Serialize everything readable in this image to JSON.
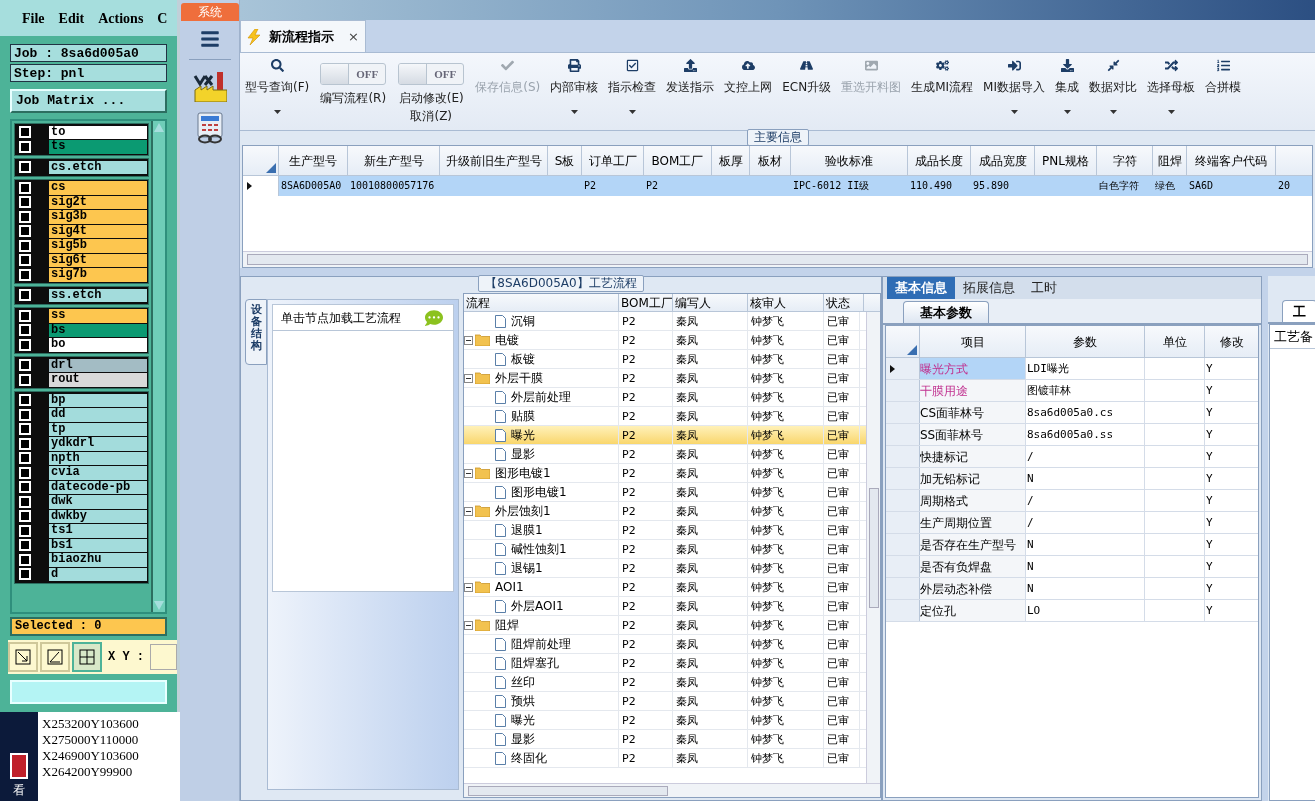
{
  "legacy_app": {
    "menus": [
      "File",
      "Edit",
      "Actions",
      "C"
    ],
    "job": "Job : 8sa6d005a0",
    "step": "Step: pnl",
    "matrix_button": "Job Matrix ...",
    "layer_groups": [
      {
        "layers": [
          {
            "name": "to",
            "color": "#ffffff",
            "checked": false
          },
          {
            "name": "ts",
            "color": "#0b9a72",
            "checked": false
          }
        ]
      },
      {
        "layers": [
          {
            "name": "cs.etch",
            "color": "#a3dcdc",
            "checked": false
          }
        ]
      },
      {
        "layers": [
          {
            "name": "cs",
            "color": "#fdc64f",
            "checked": false
          },
          {
            "name": "sig2t",
            "color": "#fdc64f",
            "checked": false
          },
          {
            "name": "sig3b",
            "color": "#fdc64f",
            "checked": false
          },
          {
            "name": "sig4t",
            "color": "#fdc64f",
            "checked": false
          },
          {
            "name": "sig5b",
            "color": "#fdc64f",
            "checked": false
          },
          {
            "name": "sig6t",
            "color": "#fdc64f",
            "checked": false
          },
          {
            "name": "sig7b",
            "color": "#fdc64f",
            "checked": false
          }
        ]
      },
      {
        "layers": [
          {
            "name": "ss.etch",
            "color": "#a3dcdc",
            "checked": false
          }
        ]
      },
      {
        "layers": [
          {
            "name": "ss",
            "color": "#fdc64f",
            "checked": false
          },
          {
            "name": "bs",
            "color": "#0b9a72",
            "checked": false
          },
          {
            "name": "bo",
            "color": "#ffffff",
            "checked": false
          }
        ]
      },
      {
        "layers": [
          {
            "name": "drl",
            "color": "#a3bcc4",
            "checked": false
          },
          {
            "name": "rout",
            "color": "#d9d9d9",
            "checked": false
          }
        ]
      },
      {
        "layers": [
          {
            "name": "bp",
            "color": "#a3dcdc",
            "checked": false
          },
          {
            "name": "dd",
            "color": "#a3dcdc",
            "checked": false
          },
          {
            "name": "tp",
            "color": "#a3dcdc",
            "checked": false
          },
          {
            "name": "ydkdrl",
            "color": "#a3dcdc",
            "checked": false
          },
          {
            "name": "npth",
            "color": "#a3dcdc",
            "checked": false
          },
          {
            "name": "cvia",
            "color": "#a3dcdc",
            "checked": false
          },
          {
            "name": "datecode-pb",
            "color": "#a3dcdc",
            "checked": false
          },
          {
            "name": "dwk",
            "color": "#a3dcdc",
            "checked": false
          },
          {
            "name": "dwkby",
            "color": "#a3dcdc",
            "checked": false
          },
          {
            "name": "ts1",
            "color": "#a3dcdc",
            "checked": false
          },
          {
            "name": "bs1",
            "color": "#a3dcdc",
            "checked": false
          },
          {
            "name": "biaozhu",
            "color": "#a3dcdc",
            "checked": false
          },
          {
            "name": "d",
            "color": "#a3dcdc",
            "checked": false
          }
        ]
      }
    ],
    "selected_count": "Selected : 0",
    "xy_label": "X Y :",
    "coordinates": [
      "X253200Y103600",
      "X275000Y110000",
      "X246900Y103600",
      "X264200Y99900"
    ],
    "taskbar_label": "看"
  },
  "sidebar": {
    "system_tab": "系统"
  },
  "tab": {
    "title": "新流程指示",
    "close": "×"
  },
  "toolbar": [
    {
      "kind": "button",
      "label": "型号查询(F)",
      "dropdown": true,
      "disabled": false
    },
    {
      "kind": "toggle",
      "state": "OFF",
      "on": false,
      "label": "编写流程(R)"
    },
    {
      "kind": "toggle",
      "state": "OFF",
      "on": false,
      "label": "启动修改(E)",
      "sublabel": "取消(Z)"
    },
    {
      "kind": "button",
      "label": "保存信息(S)",
      "dropdown": false,
      "disabled": true
    },
    {
      "kind": "button",
      "label": "内部审核",
      "dropdown": true,
      "disabled": false
    },
    {
      "kind": "button",
      "label": "指示检查",
      "dropdown": true,
      "disabled": false
    },
    {
      "kind": "button",
      "label": "发送指示",
      "dropdown": false,
      "disabled": false
    },
    {
      "kind": "button",
      "label": "文控上网",
      "dropdown": false,
      "disabled": false
    },
    {
      "kind": "button",
      "label": "ECN升级",
      "dropdown": false,
      "disabled": false
    },
    {
      "kind": "button",
      "label": "重选开料图",
      "dropdown": false,
      "disabled": true
    },
    {
      "kind": "button",
      "label": "生成MI流程",
      "dropdown": false,
      "disabled": false
    },
    {
      "kind": "button",
      "label": "MI数据导入",
      "dropdown": true,
      "disabled": false
    },
    {
      "kind": "button",
      "label": "集成",
      "dropdown": true,
      "disabled": false
    },
    {
      "kind": "button",
      "label": "数据对比",
      "dropdown": true,
      "disabled": false
    },
    {
      "kind": "button",
      "label": "选择母板",
      "dropdown": true,
      "disabled": false
    },
    {
      "kind": "button",
      "label": "合拼模",
      "dropdown": false,
      "disabled": false
    }
  ],
  "main_info": {
    "title": "主要信息",
    "columns": [
      "生产型号",
      "新生产型号",
      "升级前旧生产型号",
      "S板",
      "订单工厂",
      "BOM工厂",
      "板厚",
      "板材",
      "验收标准",
      "成品长度",
      "成品宽度",
      "PNL规格",
      "字符",
      "阻焊",
      "终端客户代码"
    ],
    "rows": [
      {
        "selected": true,
        "cells": [
          "8SA6D005A0",
          "10010800057176",
          "",
          "",
          "P2",
          "P2",
          "",
          "",
          "IPC-6012 II级",
          "110.490",
          "95.890",
          "",
          "白色字符",
          "绿色",
          "SA6D",
          "20"
        ]
      }
    ]
  },
  "process": {
    "title": "【8SA6D005A0】工艺流程",
    "side_tab": "设备结构",
    "hint": "单击节点加载工艺流程",
    "columns": [
      "流程",
      "BOM工厂",
      "编写人",
      "核审人",
      "状态"
    ],
    "tree": [
      {
        "children": [
          {
            "label": "沉铜",
            "bom": "P2",
            "writer": "秦凤",
            "reviewer": "钟梦飞",
            "status": "已审",
            "selected": false
          }
        ]
      },
      {
        "label": "电镀",
        "bom": "P2",
        "writer": "秦凤",
        "reviewer": "钟梦飞",
        "status": "已审",
        "selected": false,
        "expanded": true,
        "children": [
          {
            "label": "板镀",
            "bom": "P2",
            "writer": "秦凤",
            "reviewer": "钟梦飞",
            "status": "已审",
            "selected": false
          }
        ]
      },
      {
        "label": "外层干膜",
        "bom": "P2",
        "writer": "秦凤",
        "reviewer": "钟梦飞",
        "status": "已审",
        "selected": false,
        "expanded": true,
        "children": [
          {
            "label": "外层前处理",
            "bom": "P2",
            "writer": "秦凤",
            "reviewer": "钟梦飞",
            "status": "已审",
            "selected": false
          },
          {
            "label": "贴膜",
            "bom": "P2",
            "writer": "秦凤",
            "reviewer": "钟梦飞",
            "status": "已审",
            "selected": false
          },
          {
            "label": "曝光",
            "bom": "P2",
            "writer": "秦凤",
            "reviewer": "钟梦飞",
            "status": "已审",
            "selected": true
          },
          {
            "label": "显影",
            "bom": "P2",
            "writer": "秦凤",
            "reviewer": "钟梦飞",
            "status": "已审",
            "selected": false
          }
        ]
      },
      {
        "label": "图形电镀1",
        "bom": "P2",
        "writer": "秦凤",
        "reviewer": "钟梦飞",
        "status": "已审",
        "selected": false,
        "expanded": true,
        "children": [
          {
            "label": "图形电镀1",
            "bom": "P2",
            "writer": "秦凤",
            "reviewer": "钟梦飞",
            "status": "已审",
            "selected": false
          }
        ]
      },
      {
        "label": "外层蚀刻1",
        "bom": "P2",
        "writer": "秦凤",
        "reviewer": "钟梦飞",
        "status": "已审",
        "selected": false,
        "expanded": true,
        "children": [
          {
            "label": "退膜1",
            "bom": "P2",
            "writer": "秦凤",
            "reviewer": "钟梦飞",
            "status": "已审",
            "selected": false
          },
          {
            "label": "碱性蚀刻1",
            "bom": "P2",
            "writer": "秦凤",
            "reviewer": "钟梦飞",
            "status": "已审",
            "selected": false
          },
          {
            "label": "退锡1",
            "bom": "P2",
            "writer": "秦凤",
            "reviewer": "钟梦飞",
            "status": "已审",
            "selected": false
          }
        ]
      },
      {
        "label": "AOI1",
        "bom": "P2",
        "writer": "秦凤",
        "reviewer": "钟梦飞",
        "status": "已审",
        "selected": false,
        "expanded": true,
        "children": [
          {
            "label": "外层AOI1",
            "bom": "P2",
            "writer": "秦凤",
            "reviewer": "钟梦飞",
            "status": "已审",
            "selected": false
          }
        ]
      },
      {
        "label": "阻焊",
        "bom": "P2",
        "writer": "秦凤",
        "reviewer": "钟梦飞",
        "status": "已审",
        "selected": false,
        "expanded": true,
        "children": [
          {
            "label": "阻焊前处理",
            "bom": "P2",
            "writer": "秦凤",
            "reviewer": "钟梦飞",
            "status": "已审",
            "selected": false
          },
          {
            "label": "阻焊塞孔",
            "bom": "P2",
            "writer": "秦凤",
            "reviewer": "钟梦飞",
            "status": "已审",
            "selected": false
          },
          {
            "label": "丝印",
            "bom": "P2",
            "writer": "秦凤",
            "reviewer": "钟梦飞",
            "status": "已审",
            "selected": false
          },
          {
            "label": "预烘",
            "bom": "P2",
            "writer": "秦凤",
            "reviewer": "钟梦飞",
            "status": "已审",
            "selected": false
          },
          {
            "label": "曝光",
            "bom": "P2",
            "writer": "秦凤",
            "reviewer": "钟梦飞",
            "status": "已审",
            "selected": false
          },
          {
            "label": "显影",
            "bom": "P2",
            "writer": "秦凤",
            "reviewer": "钟梦飞",
            "status": "已审",
            "selected": false
          },
          {
            "label": "终固化",
            "bom": "P2",
            "writer": "秦凤",
            "reviewer": "钟梦飞",
            "status": "已审",
            "selected": false
          }
        ]
      }
    ]
  },
  "details": {
    "tabs": [
      {
        "label": "基本信息",
        "selected": true
      },
      {
        "label": "拓展信息",
        "selected": false
      },
      {
        "label": "工时",
        "selected": false
      }
    ],
    "sub_tab": "基本参数",
    "columns": [
      "项目",
      "参数",
      "单位",
      "修改"
    ],
    "rows": [
      {
        "item": "曝光方式",
        "value": "LDI曝光",
        "editable": "Y",
        "required": true,
        "selected": true
      },
      {
        "item": "干膜用途",
        "value": "图镀菲林",
        "editable": "Y",
        "required": true,
        "selected": false
      },
      {
        "item": "CS面菲林号",
        "value": "8sa6d005a0.cs",
        "editable": "Y",
        "required": false,
        "selected": false
      },
      {
        "item": "SS面菲林号",
        "value": "8sa6d005a0.ss",
        "editable": "Y",
        "required": false,
        "selected": false
      },
      {
        "item": "快捷标记",
        "value": "/",
        "editable": "Y",
        "required": false,
        "selected": false
      },
      {
        "item": "加无铅标记",
        "value": "N",
        "editable": "Y",
        "required": false,
        "selected": false
      },
      {
        "item": "周期格式",
        "value": "/",
        "editable": "Y",
        "required": false,
        "selected": false
      },
      {
        "item": "生产周期位置",
        "value": "/",
        "editable": "Y",
        "required": false,
        "selected": false
      },
      {
        "item": "是否存在生产型号",
        "value": "N",
        "editable": "Y",
        "required": false,
        "selected": false
      },
      {
        "item": "是否有负焊盘",
        "value": "N",
        "editable": "Y",
        "required": false,
        "selected": false
      },
      {
        "item": "外层动态补偿",
        "value": "N",
        "editable": "Y",
        "required": false,
        "selected": false
      },
      {
        "item": "定位孔",
        "value": "LO",
        "editable": "Y",
        "required": false,
        "selected": false
      }
    ]
  },
  "side_panel": {
    "tab": "工",
    "text": "工艺备"
  }
}
